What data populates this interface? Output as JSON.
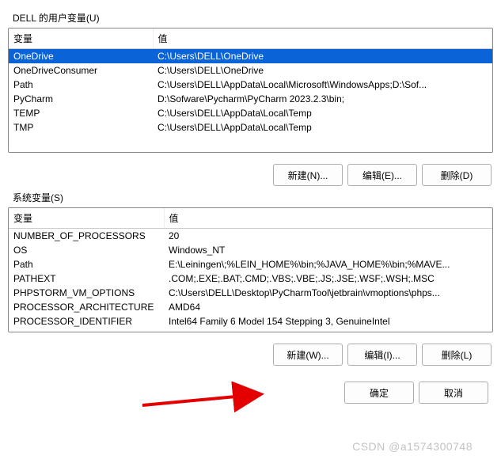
{
  "user_section": {
    "label": "DELL 的用户变量(U)",
    "headers": {
      "name": "变量",
      "value": "值"
    },
    "rows": [
      {
        "name": "OneDrive",
        "value": "C:\\Users\\DELL\\OneDrive",
        "selected": true
      },
      {
        "name": "OneDriveConsumer",
        "value": "C:\\Users\\DELL\\OneDrive"
      },
      {
        "name": "Path",
        "value": "C:\\Users\\DELL\\AppData\\Local\\Microsoft\\WindowsApps;D:\\Sof..."
      },
      {
        "name": "PyCharm",
        "value": "D:\\Sofware\\Pycharm\\PyCharm 2023.2.3\\bin;"
      },
      {
        "name": "TEMP",
        "value": "C:\\Users\\DELL\\AppData\\Local\\Temp"
      },
      {
        "name": "TMP",
        "value": "C:\\Users\\DELL\\AppData\\Local\\Temp"
      }
    ],
    "buttons": {
      "new": "新建(N)...",
      "edit": "编辑(E)...",
      "delete": "删除(D)"
    }
  },
  "system_section": {
    "label": "系统变量(S)",
    "headers": {
      "name": "变量",
      "value": "值"
    },
    "rows": [
      {
        "name": "NUMBER_OF_PROCESSORS",
        "value": "20"
      },
      {
        "name": "OS",
        "value": "Windows_NT"
      },
      {
        "name": "Path",
        "value": "E:\\Leiningen\\;%LEIN_HOME%\\bin;%JAVA_HOME%\\bin;%MAVE..."
      },
      {
        "name": "PATHEXT",
        "value": ".COM;.EXE;.BAT;.CMD;.VBS;.VBE;.JS;.JSE;.WSF;.WSH;.MSC"
      },
      {
        "name": "PHPSTORM_VM_OPTIONS",
        "value": "C:\\Users\\DELL\\Desktop\\PyCharmTool\\jetbrain\\vmoptions\\phps..."
      },
      {
        "name": "PROCESSOR_ARCHITECTURE",
        "value": "AMD64"
      },
      {
        "name": "PROCESSOR_IDENTIFIER",
        "value": "Intel64 Family 6 Model 154 Stepping 3, GenuineIntel"
      }
    ],
    "buttons": {
      "new": "新建(W)...",
      "edit": "编辑(I)...",
      "delete": "删除(L)"
    }
  },
  "dialog_buttons": {
    "ok": "确定",
    "cancel": "取消"
  },
  "watermark": "CSDN @a1574300748"
}
